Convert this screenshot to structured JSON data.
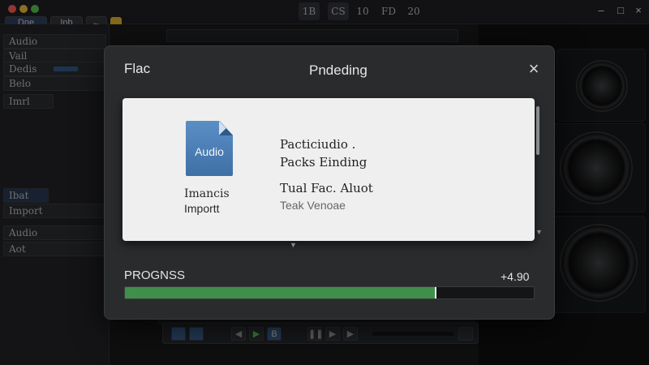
{
  "titlebar": {
    "tabs": [
      "Dne",
      "Inb",
      "←"
    ],
    "center_buttons": [
      "1B",
      "CS",
      "10",
      "FD",
      "20"
    ]
  },
  "leftpanel": {
    "tracks": [
      "Audio",
      "Vail",
      "Dedis",
      "Belo",
      "Imrl",
      "Ibat",
      "Import",
      "Audio",
      "Aot"
    ]
  },
  "modal": {
    "left_title": "Flac",
    "title": "Pndeding",
    "close_label": "×",
    "file_icon_label": "Audio",
    "file_caption_line1": "Imancis",
    "file_caption_line2": "Importt",
    "info_line1": "Pacticiudio .",
    "info_line2": "Packs Einding",
    "info_line3": "Tual Fac. Aluot",
    "info_line4": "Teak Venoae"
  },
  "progress": {
    "label": "PROGNSS",
    "value_text": "+4.90",
    "fraction": 0.76,
    "fill_color": "#3f8f4a"
  },
  "icons": [
    "close-icon",
    "file-audio-icon",
    "play-icon",
    "stop-icon",
    "fast-forward-icon"
  ]
}
